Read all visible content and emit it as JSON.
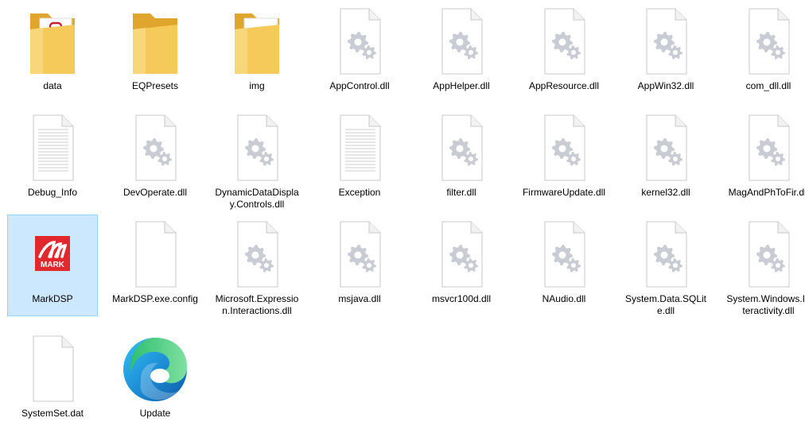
{
  "explorer": {
    "colors": {
      "selection_bg": "#cce8ff",
      "selection_border": "#99d1ff",
      "folder_yellow": "#f5c95a",
      "gear_gray": "#c9cdd3",
      "brand_red": "#e0282d"
    },
    "items": [
      {
        "name": "data",
        "icon": "folder-icon",
        "selected": false
      },
      {
        "name": "EQPresets",
        "icon": "folder-icon",
        "selected": false
      },
      {
        "name": "img",
        "icon": "folder-icon",
        "selected": false
      },
      {
        "name": "AppControl.dll",
        "icon": "dll-gear-icon",
        "selected": false
      },
      {
        "name": "AppHelper.dll",
        "icon": "dll-gear-icon",
        "selected": false
      },
      {
        "name": "AppResource.dll",
        "icon": "dll-gear-icon",
        "selected": false
      },
      {
        "name": "AppWin32.dll",
        "icon": "dll-gear-icon",
        "selected": false
      },
      {
        "name": "com_dll.dll",
        "icon": "dll-gear-icon",
        "selected": false
      },
      {
        "name": "Debug_Info",
        "icon": "text-document-icon",
        "selected": false
      },
      {
        "name": "DevOperate.dll",
        "icon": "dll-gear-icon",
        "selected": false
      },
      {
        "name": "DynamicDataDisplay.Controls.dll",
        "icon": "dll-gear-icon",
        "selected": false
      },
      {
        "name": "Exception",
        "icon": "text-document-icon",
        "selected": false
      },
      {
        "name": "filter.dll",
        "icon": "dll-gear-icon",
        "selected": false
      },
      {
        "name": "FirmwareUpdate.dll",
        "icon": "dll-gear-icon",
        "selected": false
      },
      {
        "name": "kernel32.dll",
        "icon": "dll-gear-icon",
        "selected": false
      },
      {
        "name": "MagAndPhToFir.dll",
        "icon": "dll-gear-icon",
        "selected": false
      },
      {
        "name": "MarkDSP",
        "icon": "mark-app-icon",
        "selected": true
      },
      {
        "name": "MarkDSP.exe.config",
        "icon": "blank-file-icon",
        "selected": false
      },
      {
        "name": "Microsoft.Expression.Interactions.dll",
        "icon": "dll-gear-icon",
        "selected": false
      },
      {
        "name": "msjava.dll",
        "icon": "dll-gear-icon",
        "selected": false
      },
      {
        "name": "msvcr100d.dll",
        "icon": "dll-gear-icon",
        "selected": false
      },
      {
        "name": "NAudio.dll",
        "icon": "dll-gear-icon",
        "selected": false
      },
      {
        "name": "System.Data.SQLite.dll",
        "icon": "dll-gear-icon",
        "selected": false
      },
      {
        "name": "System.Windows.Interactivity.dll",
        "icon": "dll-gear-icon",
        "selected": false
      },
      {
        "name": "SystemSet.dat",
        "icon": "blank-file-icon",
        "selected": false
      },
      {
        "name": "Update",
        "icon": "edge-browser-icon",
        "selected": false
      }
    ],
    "logo_text": "MARK"
  }
}
